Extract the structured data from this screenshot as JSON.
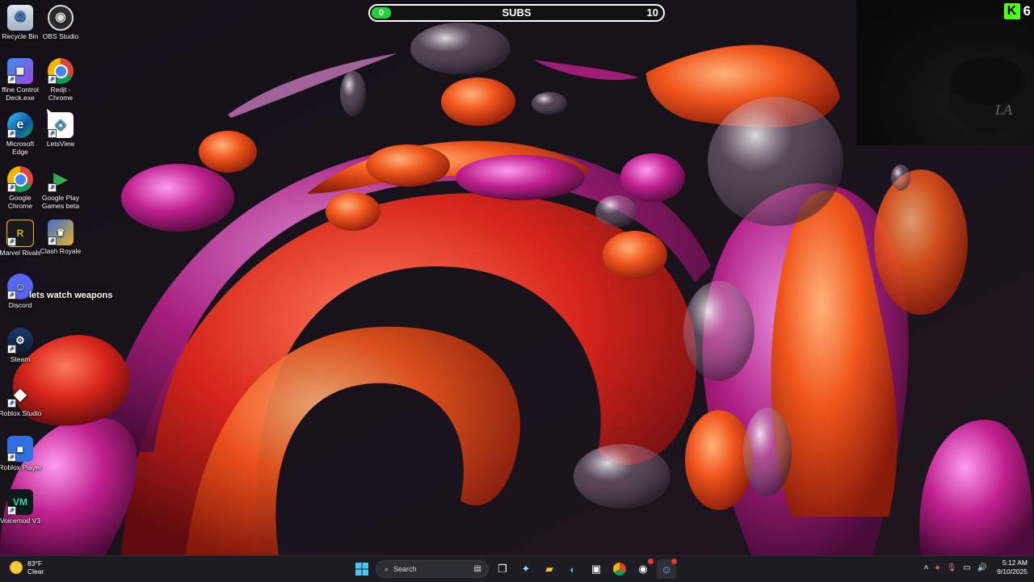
{
  "subs_goal": {
    "label": "SUBS",
    "current": "0",
    "goal": "10",
    "progress": 0,
    "fill_color": "#22d13a"
  },
  "stream_overlay": {
    "platform_icon": "kick-icon",
    "viewer_count": "6",
    "chat_message": "lets watch weapons"
  },
  "desktop_icons": [
    {
      "id": "recycle-bin",
      "label": "Recycle Bin",
      "icon": "recycle-bin-icon"
    },
    {
      "id": "obs-studio",
      "label": "OBS Studio",
      "icon": "obs-icon"
    },
    {
      "id": "control-deck",
      "label": "ffine Control Deck.exe",
      "icon": "control-deck-icon"
    },
    {
      "id": "redjt-chrome",
      "label": "Redjt - Chrome",
      "icon": "chrome-icon"
    },
    {
      "id": "microsoft-edge",
      "label": "Microsoft Edge",
      "icon": "edge-icon"
    },
    {
      "id": "letsview",
      "label": "LetsView",
      "icon": "letsview-icon"
    },
    {
      "id": "google-chrome",
      "label": "Google Chrome",
      "icon": "chrome-icon"
    },
    {
      "id": "google-play-games",
      "label": "Google Play Games beta",
      "icon": "google-play-games-icon"
    },
    {
      "id": "marvel-rivals",
      "label": "Marvel Rivals",
      "icon": "marvel-rivals-icon"
    },
    {
      "id": "clash-royale",
      "label": "Clash Royale",
      "icon": "clash-royale-icon"
    },
    {
      "id": "discord",
      "label": "Discord",
      "icon": "discord-icon"
    },
    {
      "id": "steam",
      "label": "Steam",
      "icon": "steam-icon"
    },
    {
      "id": "roblox-studio",
      "label": "Roblox Studio",
      "icon": "roblox-studio-icon"
    },
    {
      "id": "roblox-player",
      "label": "Roblox Player",
      "icon": "roblox-player-icon"
    },
    {
      "id": "voicemod",
      "label": "Voicemod V3",
      "icon": "voicemod-icon"
    }
  ],
  "taskbar": {
    "weather_temp": "83°F",
    "weather_desc": "Clear",
    "search_placeholder": "Search",
    "clock_time": "5:12 AM",
    "clock_date": "9/10/2025",
    "pinned": [
      "start-icon",
      "search-icon",
      "task-view-icon",
      "copilot-icon",
      "file-explorer-icon",
      "edge-icon",
      "store-icon",
      "chrome-icon",
      "obs-icon",
      "discord-icon"
    ]
  }
}
